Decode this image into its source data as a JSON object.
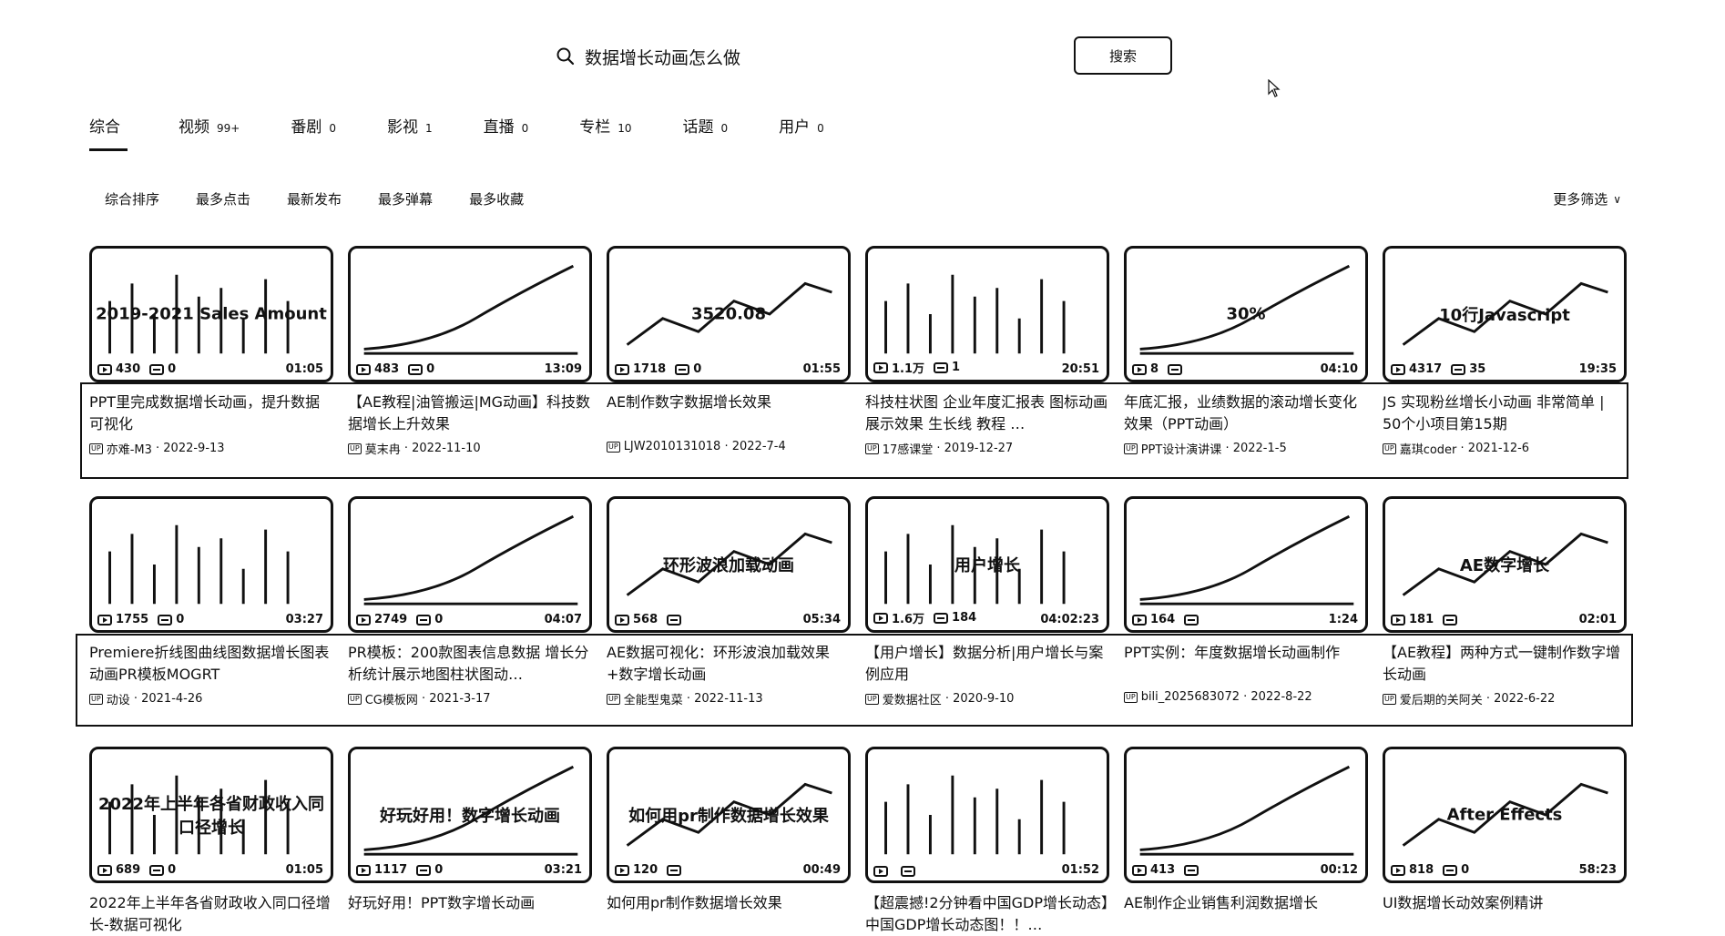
{
  "search": {
    "query": "数据增长动画怎么做",
    "button_label": "搜索"
  },
  "tabs": [
    {
      "label": "综合",
      "count": ""
    },
    {
      "label": "视频",
      "count": "99+"
    },
    {
      "label": "番剧",
      "count": "0"
    },
    {
      "label": "影视",
      "count": "1"
    },
    {
      "label": "直播",
      "count": "0"
    },
    {
      "label": "专栏",
      "count": "10"
    },
    {
      "label": "话题",
      "count": "0"
    },
    {
      "label": "用户",
      "count": "0"
    }
  ],
  "sort_options": [
    "综合排序",
    "最多点击",
    "最新发布",
    "最多弹幕",
    "最多收藏"
  ],
  "more_filters": "更多筛选",
  "up_badge": "UP",
  "videos": [
    {
      "title": "PPT里完成数据增长动画，提升数据可视化",
      "author": "亦难-M3",
      "date": "2022-9-13",
      "views": "430",
      "danmaku": "0",
      "duration": "01:05",
      "thumb_text": "2019-2021 Sales Amount"
    },
    {
      "title": "【AE教程|油管搬运|MG动画】科技数据增长上升效果",
      "author": "莫末冉",
      "date": "2022-11-10",
      "views": "483",
      "danmaku": "0",
      "duration": "13:09",
      "thumb_text": ""
    },
    {
      "title": "AE制作数字数据增长效果",
      "author": "LJW2010131018",
      "date": "2022-7-4",
      "views": "1718",
      "danmaku": "0",
      "duration": "01:55",
      "thumb_text": "3520.08"
    },
    {
      "title": "科技柱状图 企业年度汇报表 图标动画展示效果 生长线 教程 …",
      "author": "17感课堂",
      "date": "2019-12-27",
      "views": "1.1万",
      "danmaku": "1",
      "duration": "20:51",
      "thumb_text": ""
    },
    {
      "title": "年底汇报，业绩数据的滚动增长变化效果（PPT动画）",
      "author": "PPT设计演讲课",
      "date": "2022-1-5",
      "views": "8",
      "danmaku": "",
      "duration": "04:10",
      "thumb_text": "30%"
    },
    {
      "title": "JS 实现粉丝增长小动画 非常简单 | 50个小项目第15期",
      "author": "嘉琪coder",
      "date": "2021-12-6",
      "views": "4317",
      "danmaku": "35",
      "duration": "19:35",
      "thumb_text": "10行Javascript"
    },
    {
      "title": "Premiere折线图曲线图数据增长图表动画PR模板MOGRT",
      "author": "动设",
      "date": "2021-4-26",
      "views": "1755",
      "danmaku": "0",
      "duration": "03:27",
      "thumb_text": ""
    },
    {
      "title": "PR模板：200款图表信息数据 增长分析统计展示地图柱状图动…",
      "author": "CG模板网",
      "date": "2021-3-17",
      "views": "2749",
      "danmaku": "0",
      "duration": "04:07",
      "thumb_text": ""
    },
    {
      "title": "AE数据可视化：环形波浪加载效果+数字增长动画",
      "author": "全能型鬼菜",
      "date": "2022-11-13",
      "views": "568",
      "danmaku": "",
      "duration": "05:34",
      "thumb_text": "环形波浪加载动画"
    },
    {
      "title": "【用户增长】数据分析|用户增长与案例应用",
      "author": "爱数据社区",
      "date": "2020-9-10",
      "views": "1.6万",
      "danmaku": "184",
      "duration": "04:02:23",
      "thumb_text": "用户增长"
    },
    {
      "title": "PPT实例：年度数据增长动画制作",
      "author": "bili_2025683072",
      "date": "2022-8-22",
      "views": "164",
      "danmaku": "",
      "duration": "1:24",
      "thumb_text": ""
    },
    {
      "title": "【AE教程】两种方式一键制作数字增长动画",
      "author": "爱后期的关阿关",
      "date": "2022-6-22",
      "views": "181",
      "danmaku": "",
      "duration": "02:01",
      "thumb_text": "AE数字增长"
    },
    {
      "title": "2022年上半年各省财政收入同口径增长-数据可视化",
      "author": "",
      "date": "",
      "views": "689",
      "danmaku": "0",
      "duration": "01:05",
      "thumb_text": "2022年上半年各省财政收入同口径增长"
    },
    {
      "title": "好玩好用！PPT数字增长动画",
      "author": "",
      "date": "",
      "views": "1117",
      "danmaku": "0",
      "duration": "03:21",
      "thumb_text": "好玩好用！数字增长动画"
    },
    {
      "title": "如何用pr制作数据增长效果",
      "author": "",
      "date": "",
      "views": "120",
      "danmaku": "",
      "duration": "00:49",
      "thumb_text": "如何用pr制作数据增长效果"
    },
    {
      "title": "【超震撼!2分钟看中国GDP增长动态】中国GDP增长动态图！！…",
      "author": "",
      "date": "",
      "views": "",
      "danmaku": "",
      "duration": "01:52",
      "thumb_text": ""
    },
    {
      "title": "AE制作企业销售利润数据增长",
      "author": "",
      "date": "",
      "views": "413",
      "danmaku": "",
      "duration": "00:12",
      "thumb_text": ""
    },
    {
      "title": "UI数据增长动效案例精讲",
      "author": "",
      "date": "",
      "views": "818",
      "danmaku": "0",
      "duration": "58:23",
      "thumb_text": "After Effects"
    }
  ]
}
